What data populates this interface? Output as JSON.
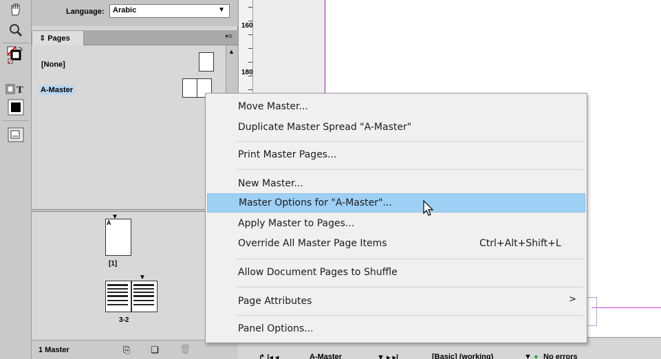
{
  "panel": {
    "language_label": "Language:",
    "language_value": "Arabic",
    "pages_tab": "Pages",
    "masters": [
      "[None]",
      "A-Master"
    ],
    "page_labels": [
      "[1]",
      "3-2"
    ],
    "status": "1 Master"
  },
  "ruler": {
    "numbers": [
      "160",
      "180"
    ]
  },
  "docbar": {
    "master": "A-Master",
    "profile": "[Basic] (working)",
    "errors": "No errors"
  },
  "context_menu": {
    "items": [
      {
        "label": "Move Master..."
      },
      {
        "label": "Duplicate Master Spread \"A-Master\""
      },
      {
        "label": "Print Master Pages..."
      },
      {
        "label": "New Master..."
      },
      {
        "label": "Master Options for \"A-Master\"...",
        "highlighted": true
      },
      {
        "label": "Apply Master to Pages..."
      },
      {
        "label": "Override All Master Page Items",
        "shortcut": "Ctrl+Alt+Shift+L"
      },
      {
        "label": "Allow Document Pages to Shuffle"
      },
      {
        "label": "Page Attributes",
        "submenu_arrow": ">"
      },
      {
        "label": "Panel Options..."
      }
    ]
  },
  "colors": {
    "highlight": "#9ed0f5",
    "page_edge": "#a01ab0",
    "guide": "#d246d2",
    "selection": "#b9d7f1",
    "status_green": "#2ea82e"
  }
}
